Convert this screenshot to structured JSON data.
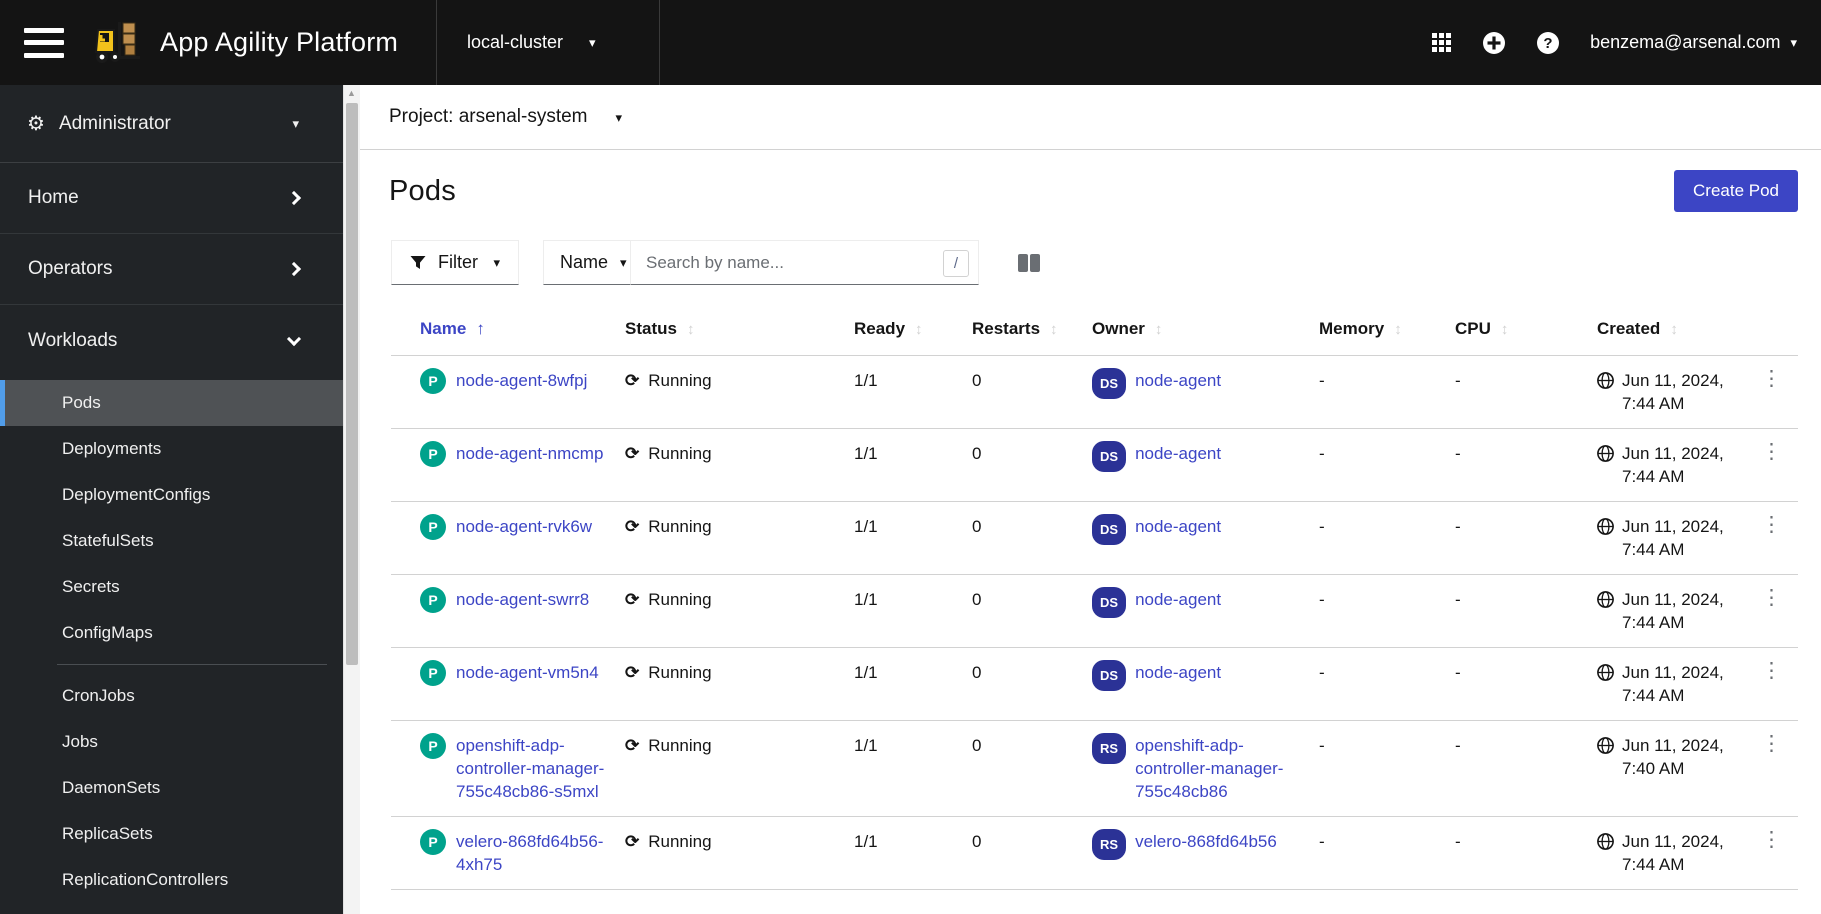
{
  "masthead": {
    "product_name": "App Agility Platform",
    "cluster": "local-cluster",
    "user_email": "benzema@arsenal.com"
  },
  "sidebar": {
    "perspective_label": "Administrator",
    "home_label": "Home",
    "operators_label": "Operators",
    "workloads_label": "Workloads",
    "workloads_items": [
      "Pods",
      "Deployments",
      "DeploymentConfigs",
      "StatefulSets",
      "Secrets",
      "ConfigMaps",
      "CronJobs",
      "Jobs",
      "DaemonSets",
      "ReplicaSets",
      "ReplicationControllers"
    ],
    "active_item": "Pods"
  },
  "content": {
    "project_label": "Project: arsenal-system",
    "page_title": "Pods",
    "create_button_label": "Create Pod",
    "toolbar": {
      "filter_label": "Filter",
      "attribute_label": "Name",
      "search_placeholder": "Search by name...",
      "search_shortcut": "/"
    },
    "table": {
      "columns": [
        "Name",
        "Status",
        "Ready",
        "Restarts",
        "Owner",
        "Memory",
        "CPU",
        "Created"
      ],
      "sorted_column": "Name",
      "sort_direction": "ascending",
      "rows": [
        {
          "badge": "P",
          "name": "node-agent-8wfpj",
          "status": "Running",
          "ready": "1/1",
          "restarts": "0",
          "owner_badge": "DS",
          "owner": "node-agent",
          "memory": "-",
          "cpu": "-",
          "created_date": "Jun 11, 2024,",
          "created_time": "7:44 AM"
        },
        {
          "badge": "P",
          "name": "node-agent-nmcmp",
          "status": "Running",
          "ready": "1/1",
          "restarts": "0",
          "owner_badge": "DS",
          "owner": "node-agent",
          "memory": "-",
          "cpu": "-",
          "created_date": "Jun 11, 2024,",
          "created_time": "7:44 AM"
        },
        {
          "badge": "P",
          "name": "node-agent-rvk6w",
          "status": "Running",
          "ready": "1/1",
          "restarts": "0",
          "owner_badge": "DS",
          "owner": "node-agent",
          "memory": "-",
          "cpu": "-",
          "created_date": "Jun 11, 2024,",
          "created_time": "7:44 AM"
        },
        {
          "badge": "P",
          "name": "node-agent-swrr8",
          "status": "Running",
          "ready": "1/1",
          "restarts": "0",
          "owner_badge": "DS",
          "owner": "node-agent",
          "memory": "-",
          "cpu": "-",
          "created_date": "Jun 11, 2024,",
          "created_time": "7:44 AM"
        },
        {
          "badge": "P",
          "name": "node-agent-vm5n4",
          "status": "Running",
          "ready": "1/1",
          "restarts": "0",
          "owner_badge": "DS",
          "owner": "node-agent",
          "memory": "-",
          "cpu": "-",
          "created_date": "Jun 11, 2024,",
          "created_time": "7:44 AM"
        },
        {
          "badge": "P",
          "name": "openshift-adp-controller-manager-755c48cb86-s5mxl",
          "status": "Running",
          "ready": "1/1",
          "restarts": "0",
          "owner_badge": "RS",
          "owner": "openshift-adp-controller-manager-755c48cb86",
          "memory": "-",
          "cpu": "-",
          "created_date": "Jun 11, 2024,",
          "created_time": "7:40 AM"
        },
        {
          "badge": "P",
          "name": "velero-868fd64b56-4xh75",
          "status": "Running",
          "ready": "1/1",
          "restarts": "0",
          "owner_badge": "RS",
          "owner": "velero-868fd64b56",
          "memory": "-",
          "cpu": "-",
          "created_date": "Jun 11, 2024,",
          "created_time": "7:44 AM"
        }
      ]
    }
  },
  "icons": {
    "gear": "⚙",
    "caret_down": "▾",
    "sort": "↕",
    "sort_asc": "↑",
    "sync": "⟳",
    "kebab": "⋮",
    "scroll_up": "▲"
  },
  "colors": {
    "accent": "#3c45c5",
    "pod_badge": "#00a28c",
    "owner_badge": "#2b3296",
    "masthead_bg": "#141414",
    "sidebar_bg": "#212427",
    "sidebar_active_bar": "#519de9"
  }
}
